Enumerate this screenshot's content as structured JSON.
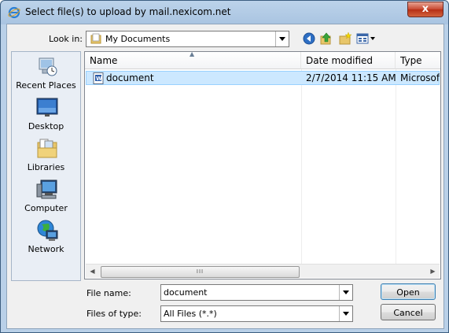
{
  "window": {
    "title": "Select file(s) to upload by mail.nexicom.net",
    "close_label": "x"
  },
  "lookin": {
    "label": "Look in:",
    "value": "My Documents"
  },
  "places": [
    {
      "label": "Recent Places",
      "icon": "recent-places-icon"
    },
    {
      "label": "Desktop",
      "icon": "desktop-icon"
    },
    {
      "label": "Libraries",
      "icon": "libraries-icon"
    },
    {
      "label": "Computer",
      "icon": "computer-icon"
    },
    {
      "label": "Network",
      "icon": "network-icon"
    }
  ],
  "columns": {
    "name": "Name",
    "date": "Date modified",
    "type": "Type"
  },
  "files": [
    {
      "name": "document",
      "date": "2/7/2014 11:15 AM",
      "type": "Microsoft"
    }
  ],
  "scrollbar": {
    "thumb_grip": "III"
  },
  "filename": {
    "label": "File name:",
    "value": "document"
  },
  "filetype": {
    "label": "Files of type:",
    "value": "All Files (*.*)"
  },
  "buttons": {
    "open": "Open",
    "cancel": "Cancel"
  },
  "colors": {
    "title_gradient": "#bcd3ea",
    "selection": "#cce8ff",
    "close_button": "#c7472f"
  }
}
